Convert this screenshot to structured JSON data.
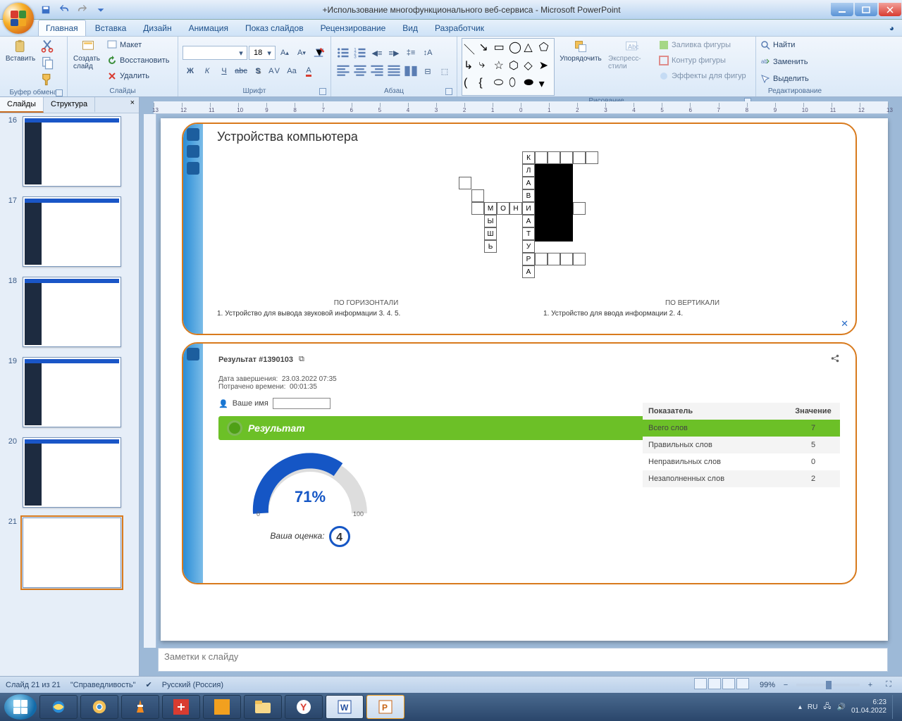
{
  "window": {
    "title": "+Использование многофункционального веб-сервиса - Microsoft PowerPoint"
  },
  "ribbon_tabs": [
    "Главная",
    "Вставка",
    "Дизайн",
    "Анимация",
    "Показ слайдов",
    "Рецензирование",
    "Вид",
    "Разработчик"
  ],
  "active_tab_index": 0,
  "ribbon": {
    "clipboard": {
      "label": "Буфер обмена",
      "paste": "Вставить"
    },
    "slides": {
      "label": "Слайды",
      "new": "Создать слайд",
      "layout": "Макет",
      "reset": "Восстановить",
      "delete": "Удалить"
    },
    "font": {
      "label": "Шрифт",
      "family": "",
      "size": "18"
    },
    "paragraph": {
      "label": "Абзац"
    },
    "drawing": {
      "label": "Рисование",
      "arrange": "Упорядочить",
      "quick": "Экспресс-стили",
      "fill": "Заливка фигуры",
      "outline": "Контур фигуры",
      "effects": "Эффекты для фигур"
    },
    "editing": {
      "label": "Редактирование",
      "find": "Найти",
      "replace": "Заменить",
      "select": "Выделить"
    }
  },
  "panel": {
    "tab_slides": "Слайды",
    "tab_outline": "Структура",
    "thumbs": [
      16,
      17,
      18,
      19,
      20,
      21
    ],
    "selected": 21
  },
  "notes_placeholder": "Заметки к слайду",
  "status": {
    "slide": "Слайд 21 из 21",
    "theme": "\"Справедливость\"",
    "lang": "Русский (Россия)",
    "zoom": "99%"
  },
  "taskbar": {
    "lang": "RU",
    "time": "6:23",
    "date": "01.04.2022"
  },
  "slide": {
    "shot1": {
      "title": "Устройства компьютера",
      "clues": {
        "horiz_header": "ПО ГОРИЗОНТАЛИ",
        "horiz": "1.  Устройство для вывода звуковой информации   3.   4.   5.",
        "vert_header": "ПО ВЕРТИКАЛИ",
        "vert": "1.  Устройство для ввода информации   2.   4."
      },
      "crossword_letters": [
        "К",
        "Л",
        "А",
        "В",
        "И",
        "А",
        "Т",
        "У",
        "Р",
        "А",
        "М",
        "О",
        "Н",
        "Ы",
        "Ш",
        "Ь"
      ]
    },
    "shot2": {
      "title": "Результат #1390103",
      "done_label": "Дата завершения:",
      "done_value": "23.03.2022 07:35",
      "time_label": "Потрачено времени:",
      "time_value": "00:01:35",
      "name_label": "Ваше имя",
      "result_header": "Результат",
      "gauge": "71%",
      "gauge_min": "0",
      "gauge_max": "100",
      "grade_label": "Ваша оценка:",
      "grade": "4",
      "table": {
        "h1": "Показатель",
        "h2": "Значение",
        "rows": [
          [
            "Всего слов",
            "7"
          ],
          [
            "Правильных слов",
            "5"
          ],
          [
            "Неправильных слов",
            "0"
          ],
          [
            "Незаполненных слов",
            "2"
          ]
        ]
      }
    }
  }
}
